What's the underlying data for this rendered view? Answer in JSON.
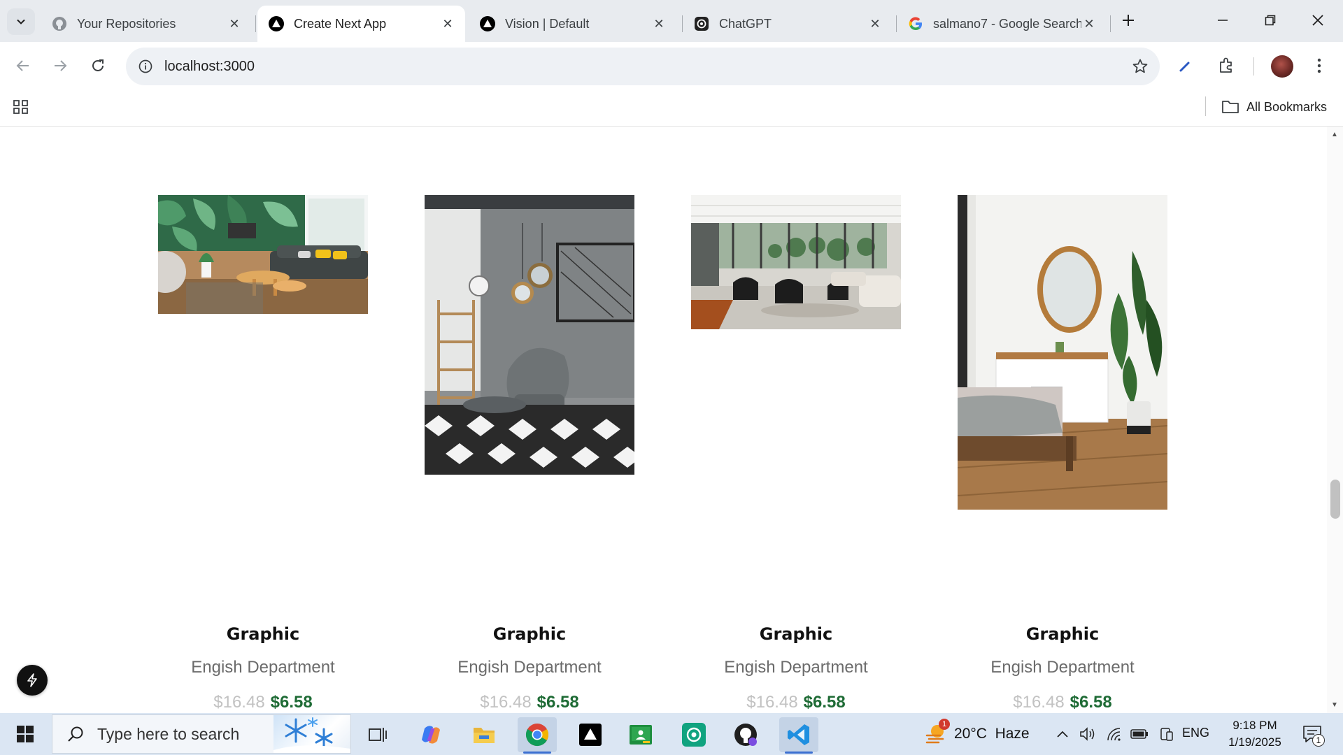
{
  "browser": {
    "tabs": [
      {
        "title": "Your Repositories",
        "icon": "github-icon"
      },
      {
        "title": "Create Next App",
        "icon": "vercel-triangle-icon",
        "active": true
      },
      {
        "title": "Vision | Default",
        "icon": "vercel-triangle-icon"
      },
      {
        "title": "ChatGPT",
        "icon": "chatgpt-icon"
      },
      {
        "title": "salmano7 - Google Search",
        "icon": "google-icon"
      }
    ],
    "url": "localhost:3000",
    "bookmarks_label": "All Bookmarks"
  },
  "products": [
    {
      "name": "Graphic",
      "department": "Engish Department",
      "old_price": "$16.48",
      "new_price": "$6.58",
      "image": "living-room-tropical-wallpaper"
    },
    {
      "name": "Graphic",
      "department": "Engish Department",
      "old_price": "$16.48",
      "new_price": "$6.58",
      "image": "concrete-room-armchair"
    },
    {
      "name": "Graphic",
      "department": "Engish Department",
      "old_price": "$16.48",
      "new_price": "$6.58",
      "image": "open-lounge-black-chairs"
    },
    {
      "name": "Graphic",
      "department": "Engish Department",
      "old_price": "$16.48",
      "new_price": "$6.58",
      "image": "bedroom-round-mirror"
    }
  ],
  "taskbar": {
    "search_placeholder": "Type here to search",
    "weather": "20°C  Haze",
    "weather_badge": "1",
    "language": "ENG",
    "time": "9:18 PM",
    "date": "1/19/2025",
    "notification_count": "1"
  },
  "colors": {
    "accent_price": "#1e6b35",
    "old_price": "#c2c2c2",
    "tabstrip_bg": "#e8ebef",
    "taskbar_bg": "#dbe6f3"
  }
}
